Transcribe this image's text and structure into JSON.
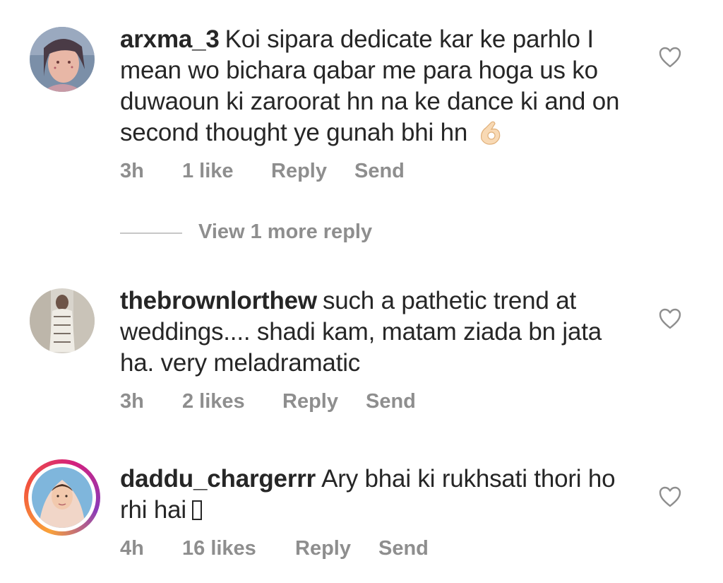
{
  "comments": [
    {
      "username": "arxma_3",
      "text": "Koi sipara dedicate kar ke parhlo I mean wo bichara qabar me para hoga us ko duwaoun ki zaroorat hn na ke dance ki and on second thought ye gunah bhi hn",
      "time": "3h",
      "likes": "1 like",
      "reply": "Reply",
      "send": "Send",
      "trailing_emoji": "ok-hand-emoji"
    },
    {
      "username": "thebrownlorthew",
      "text": "such a pathetic trend at weddings.... shadi kam, matam ziada bn jata ha. very meladramatic",
      "time": "3h",
      "likes": "2 likes",
      "reply": "Reply",
      "send": "Send"
    },
    {
      "username": "daddu_chargerrr",
      "text": "Ary bhai ki rukhsati thori ho rhi hai",
      "time": "4h",
      "likes": "16 likes",
      "reply": "Reply",
      "send": "Send",
      "has_story_ring": true
    }
  ],
  "view_more_replies": "View 1 more reply",
  "icons": {
    "like": "heart-outline-icon"
  },
  "colors": {
    "text": "#262626",
    "secondary": "#8e8e8e",
    "divider": "#c7c7c7"
  }
}
